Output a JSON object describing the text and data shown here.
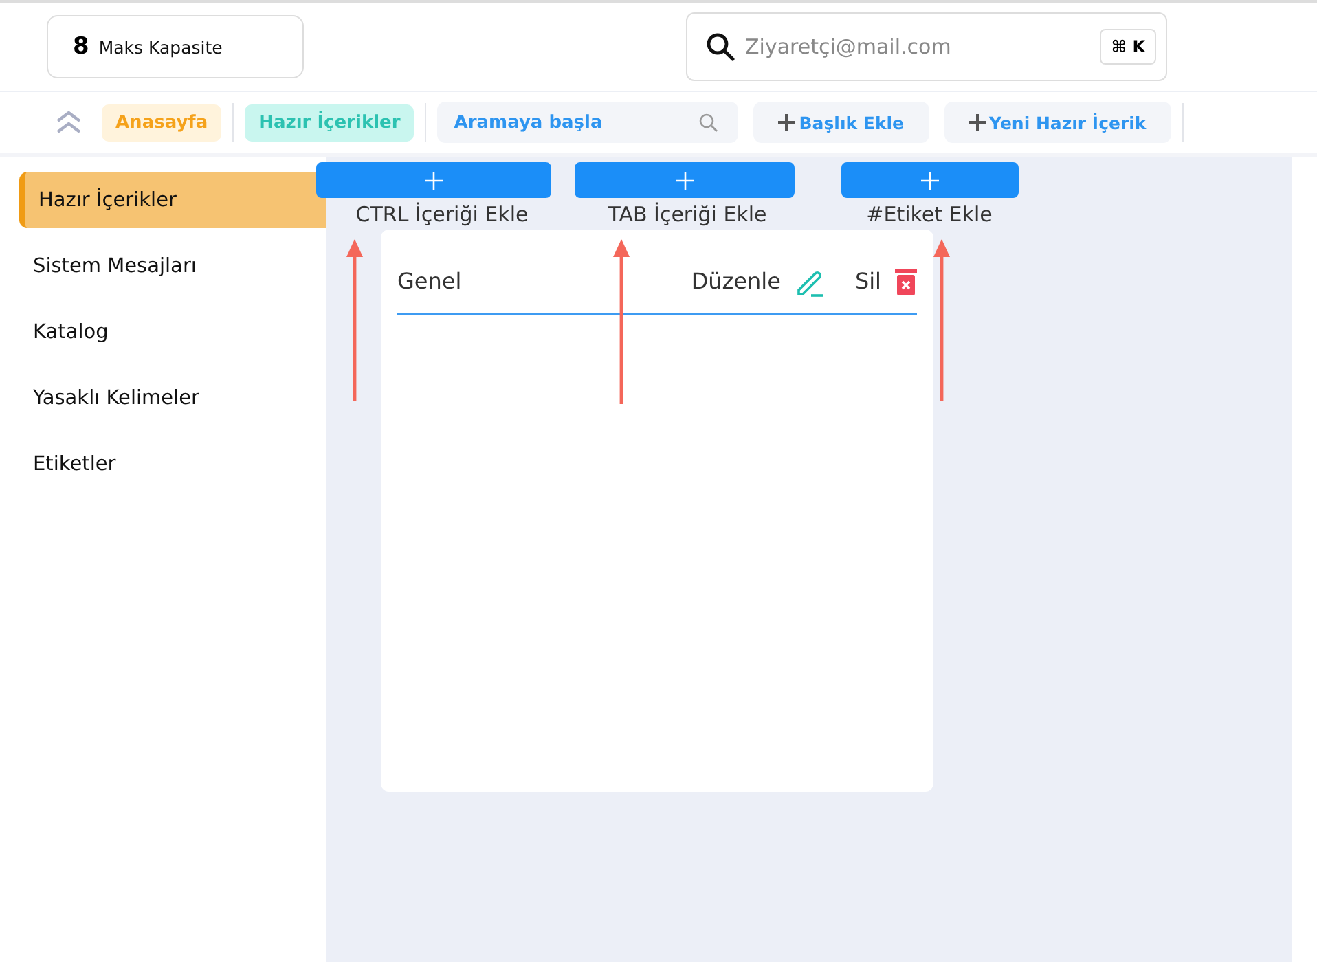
{
  "header": {
    "capacity": {
      "value": "8",
      "label": "Maks Kapasite"
    },
    "search": {
      "placeholder": "Ziyaretçi@mail.com",
      "shortcut": "⌘ K"
    }
  },
  "nav": {
    "tabs": [
      {
        "label": "Anasayfa",
        "kind": "home"
      },
      {
        "label": "Hazır İçerikler",
        "kind": "current"
      }
    ],
    "search": {
      "placeholder": "Aramaya başla"
    },
    "actions": [
      "Başlık Ekle",
      "Yeni Hazır İçerik"
    ]
  },
  "sidebar": {
    "items": [
      {
        "label": "Hazır İçerikler",
        "selected": true
      },
      {
        "label": "Sistem Mesajları",
        "selected": false
      },
      {
        "label": "Katalog",
        "selected": false
      },
      {
        "label": "Yasaklı Kelimeler",
        "selected": false
      },
      {
        "label": "Etiketler",
        "selected": false
      }
    ]
  },
  "add_buttons": [
    {
      "caption": "CTRL İçeriği Ekle"
    },
    {
      "caption": "TAB İçeriği Ekle"
    },
    {
      "caption": "#Etiket Ekle"
    }
  ],
  "card": {
    "rows": [
      {
        "title": "Genel",
        "edit": "Düzenle",
        "delete": "Sil"
      }
    ]
  }
}
